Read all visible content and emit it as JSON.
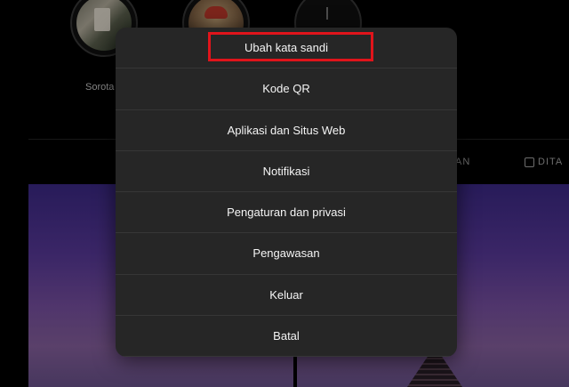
{
  "highlights": {
    "first_label": "Sorota"
  },
  "tabs": {
    "saved_fragment": "AN",
    "tagged_label": "DITA"
  },
  "menu": {
    "items": [
      "Ubah kata sandi",
      "Kode QR",
      "Aplikasi dan Situs Web",
      "Notifikasi",
      "Pengaturan dan privasi",
      "Pengawasan",
      "Keluar",
      "Batal"
    ],
    "highlighted_item": "Ubah kata sandi"
  },
  "colors": {
    "menu_bg": "#262626",
    "annotation_red": "#e0141b",
    "page_bg": "#000000"
  }
}
